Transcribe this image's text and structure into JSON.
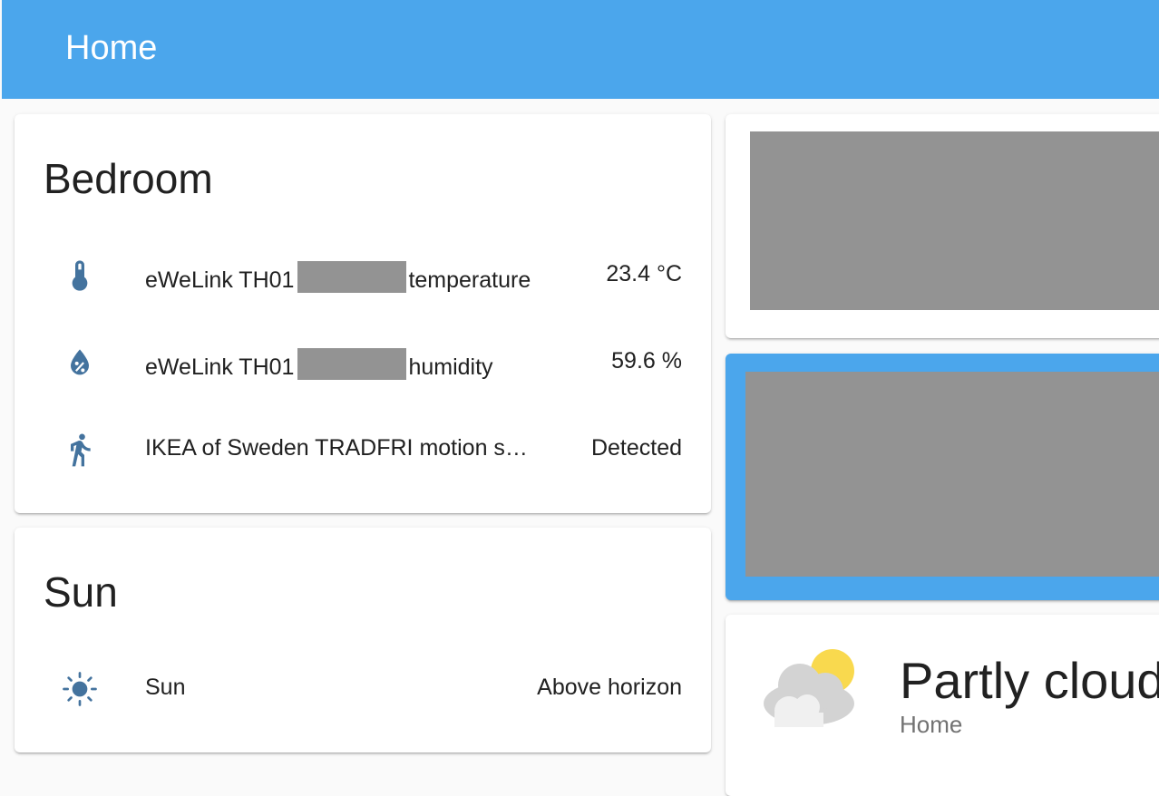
{
  "header": {
    "title": "Home"
  },
  "bedroom": {
    "title": "Bedroom",
    "rows": [
      {
        "name_prefix": "eWeLink TH01",
        "name_suffix": "temperature",
        "state": "23.4 °C",
        "icon": "thermometer-icon"
      },
      {
        "name_prefix": "eWeLink TH01",
        "name_suffix": "humidity",
        "state": "59.6 %",
        "icon": "water-percent-icon"
      },
      {
        "name": "IKEA of Sweden TRADFRI motion s…",
        "state": "Detected",
        "icon": "running-person-icon"
      }
    ]
  },
  "sun": {
    "title": "Sun",
    "rows": [
      {
        "name": "Sun",
        "state": "Above horizon",
        "icon": "sun-icon"
      }
    ]
  },
  "weather": {
    "condition": "Partly cloudy",
    "location": "Home",
    "icon": "partly-cloudy-icon"
  },
  "colors": {
    "accent": "#4ba6ec",
    "icon": "#44739e",
    "redacted": "#939393",
    "sun": "#f9d94e",
    "cloud": "#d3d3d3"
  }
}
